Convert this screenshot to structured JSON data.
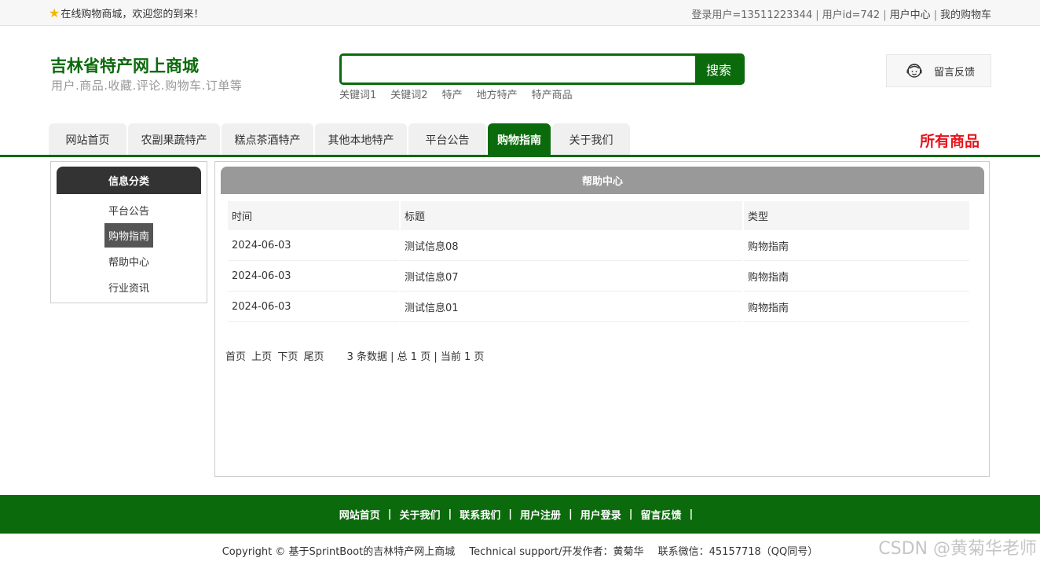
{
  "topbar": {
    "welcome": "在线购物商城，欢迎您的到来！",
    "user_info": "登录用户=13511223344",
    "user_id": "用户id=742",
    "user_center": "用户中心",
    "cart": "我的购物车"
  },
  "header": {
    "title": "吉林省特产网上商城",
    "subtitle": "用户.商品.收藏.评论.购物车.订单等",
    "search_button": "搜索",
    "hotwords": [
      "关键词1",
      "关键词2",
      "特产",
      "地方特产",
      "特产商品"
    ],
    "feedback": "留言反馈"
  },
  "nav": {
    "tabs": [
      {
        "label": "网站首页"
      },
      {
        "label": "农副果蔬特产"
      },
      {
        "label": "糕点茶酒特产"
      },
      {
        "label": "其他本地特产"
      },
      {
        "label": "平台公告"
      },
      {
        "label": "购物指南"
      },
      {
        "label": "关于我们"
      }
    ],
    "all_goods": "所有商品"
  },
  "sidebar": {
    "title": "信息分类",
    "items": [
      {
        "label": "平台公告"
      },
      {
        "label": "购物指南"
      },
      {
        "label": "帮助中心"
      },
      {
        "label": "行业资讯"
      }
    ]
  },
  "main": {
    "title": "帮助中心",
    "columns": [
      "时间",
      "标题",
      "类型"
    ],
    "rows": [
      {
        "time": "2024-06-03",
        "title": "测试信息08",
        "type": "购物指南"
      },
      {
        "time": "2024-06-03",
        "title": "测试信息07",
        "type": "购物指南"
      },
      {
        "time": "2024-06-03",
        "title": "测试信息01",
        "type": "购物指南"
      }
    ],
    "pager": {
      "first": "首页",
      "prev": "上页",
      "next": "下页",
      "last": "尾页",
      "info": "3 条数据 | 总 1 页 | 当前 1 页"
    }
  },
  "footer": {
    "links": [
      "网站首页",
      "关于我们",
      "联系我们",
      "用户注册",
      "用户登录",
      "留言反馈"
    ],
    "sep": "|",
    "copyright": "Copyright © 基于SprintBoot的吉林特产网上商城",
    "support": "Technical support/开发作者：黄菊华",
    "wechat": "联系微信：45157718（QQ同号）"
  },
  "watermark": "CSDN @黄菊华老师",
  "colors": {
    "brand_green": "#0b6a0b",
    "accent_red": "#e8141c"
  }
}
